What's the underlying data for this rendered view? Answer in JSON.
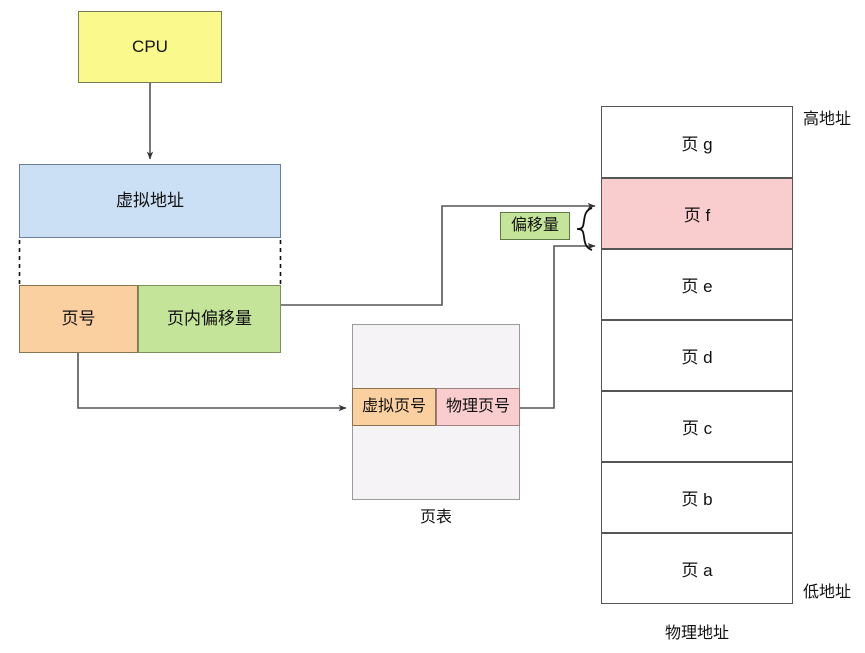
{
  "diagram": {
    "title_hidden": "虚拟地址到物理地址的分页转换示意图",
    "cpu": {
      "label": "CPU"
    },
    "virtual_address": {
      "label": "虚拟地址"
    },
    "address_split": {
      "page_number": "页号",
      "page_offset": "页内偏移量"
    },
    "page_table": {
      "caption": "页表",
      "columns": [
        "虚拟页号",
        "物理页号"
      ]
    },
    "offset_badge": {
      "label": "偏移量"
    },
    "physical_memory": {
      "caption": "物理地址",
      "high_label": "高地址",
      "low_label": "低地址",
      "pages": [
        {
          "label": "页 g",
          "highlighted": false
        },
        {
          "label": "页 f",
          "highlighted": true
        },
        {
          "label": "页 e",
          "highlighted": false
        },
        {
          "label": "页 d",
          "highlighted": false
        },
        {
          "label": "页 c",
          "highlighted": false
        },
        {
          "label": "页 b",
          "highlighted": false
        },
        {
          "label": "页 a",
          "highlighted": false
        }
      ]
    },
    "colors": {
      "cpu_fill": "#FAFA8C",
      "virtual_address_fill": "#CCE0F5",
      "page_number_fill": "#FAD0A0",
      "page_offset_fill": "#C4E49A",
      "page_table_fill": "#F5F3F5",
      "virtual_page_fill": "#FAD0A0",
      "physical_page_fill": "#F9CCCE",
      "memory_highlight_fill": "#F9CCCE",
      "memory_fill": "#FFFFFF",
      "offset_badge_fill": "#C4E49A",
      "stroke": "#555555"
    }
  }
}
